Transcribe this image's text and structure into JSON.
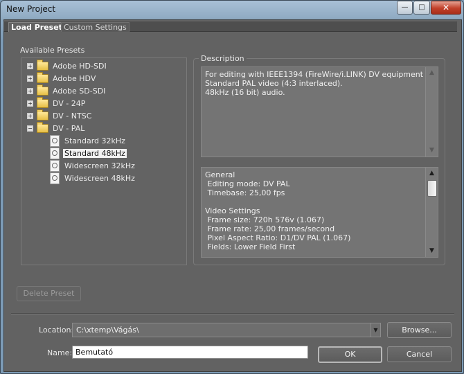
{
  "window": {
    "title": "New Project",
    "minimize_glyph": "—",
    "maximize_glyph": "□",
    "close_glyph": "✕"
  },
  "tabs": [
    {
      "label": "Load Preset",
      "active": true
    },
    {
      "label": "Custom Settings",
      "active": false
    }
  ],
  "presets": {
    "label": "Available Presets",
    "tree": [
      {
        "label": "Adobe HD-SDI",
        "type": "folder",
        "expanded": false
      },
      {
        "label": "Adobe HDV",
        "type": "folder",
        "expanded": false
      },
      {
        "label": "Adobe SD-SDI",
        "type": "folder",
        "expanded": false
      },
      {
        "label": "DV - 24P",
        "type": "folder",
        "expanded": false
      },
      {
        "label": "DV - NTSC",
        "type": "folder",
        "expanded": false
      },
      {
        "label": "DV - PAL",
        "type": "folder",
        "expanded": true
      },
      {
        "label": "Standard 32kHz",
        "type": "preset"
      },
      {
        "label": "Standard 48kHz",
        "type": "preset",
        "selected": true
      },
      {
        "label": "Widescreen 32kHz",
        "type": "preset"
      },
      {
        "label": "Widescreen 48kHz",
        "type": "preset"
      }
    ],
    "expanded_glyph": "−",
    "collapsed_glyph": "+"
  },
  "description": {
    "label": "Description",
    "text": "For editing with IEEE1394 (FireWire/i.LINK) DV equipment.\nStandard PAL video (4:3 interlaced).\n48kHz (16 bit) audio.",
    "details": "General\n Editing mode: DV PAL\n Timebase: 25,00 fps\n\nVideo Settings\n Frame size: 720h 576v (1.067)\n Frame rate: 25,00 frames/second\n Pixel Aspect Ratio: D1/DV PAL (1.067)\n Fields: Lower Field First"
  },
  "scroll": {
    "up_glyph": "▲",
    "down_glyph": "▼"
  },
  "buttons": {
    "delete_preset": "Delete Preset",
    "browse": "Browse...",
    "ok": "OK",
    "cancel": "Cancel"
  },
  "location": {
    "label": "Location:",
    "value": "C:\\xtemp\\Vágás\\",
    "dropdown_glyph": "▼"
  },
  "name": {
    "label": "Name:",
    "value": "Bemutató"
  }
}
